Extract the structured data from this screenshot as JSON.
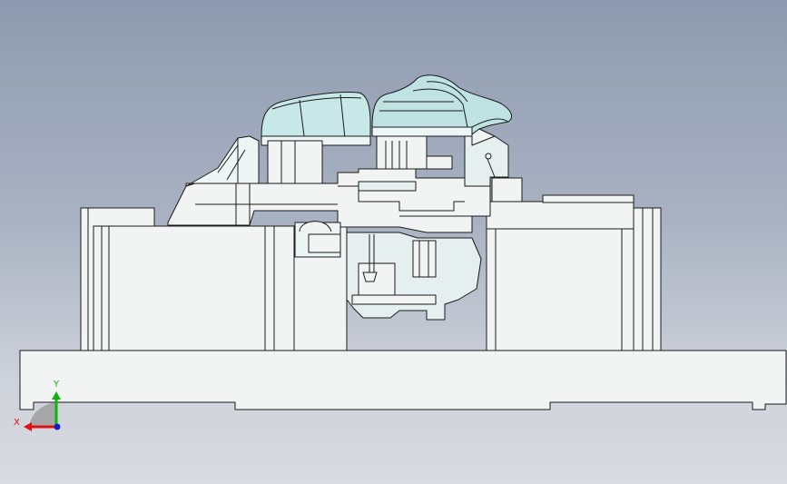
{
  "viewport": {
    "background_top": "#8e9aaf",
    "background_bottom": "#d8dbe0",
    "model_face_color": "#f2f4f4",
    "model_shade_color": "#bfe3e3",
    "model_edge_color": "#1a1a1a"
  },
  "triad": {
    "x_label": "X",
    "y_label": "Y",
    "x_color": "#e01010",
    "y_color": "#12b012",
    "z_color": "#1020d0"
  }
}
